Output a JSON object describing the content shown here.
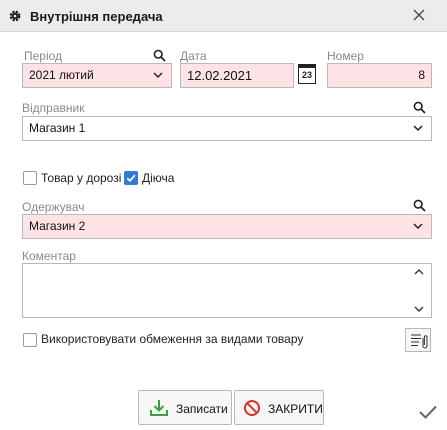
{
  "window": {
    "title": "Внутрішня передача"
  },
  "form": {
    "period": {
      "label": "Період",
      "value": "2021 лютий"
    },
    "date": {
      "label": "Дата",
      "value": "12.02.2021",
      "calendar_day": "23"
    },
    "number": {
      "label": "Номер",
      "value": "8"
    },
    "sender": {
      "label": "Відправник",
      "value": "Магазин 1"
    },
    "in_transit": {
      "label": "Товар у дорозі",
      "checked": false
    },
    "active": {
      "label": "Діюча",
      "checked": true
    },
    "receiver": {
      "label": "Одержувач",
      "value": "Магазин 2"
    },
    "comment": {
      "label": "Коментар",
      "value": ""
    },
    "restrictions": {
      "label": "Використовувати обмеження за видами товару",
      "checked": false
    }
  },
  "buttons": {
    "save": "Записати",
    "close": "ЗАКРИТИ"
  },
  "colors": {
    "required_field_bg": "#fde3e6",
    "checkbox_on": "#2f7bd6",
    "save_icon": "#3aa23a",
    "close_icon": "#d9322c"
  }
}
